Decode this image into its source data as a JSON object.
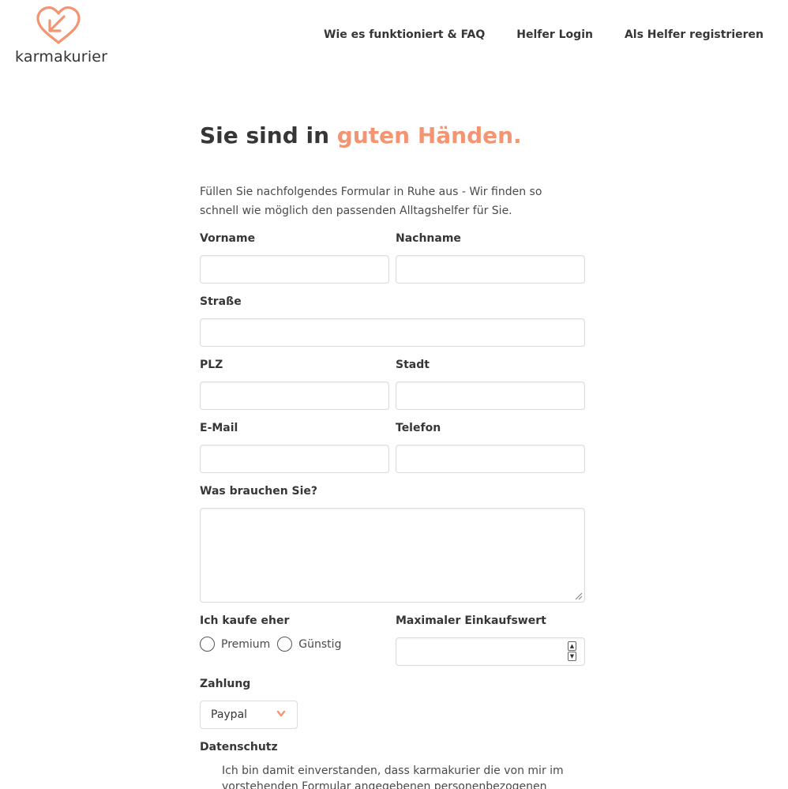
{
  "brand": {
    "name": "karmakurier",
    "accent_color": "#f39472",
    "logo_icon": "heart-arrow-icon"
  },
  "nav": [
    {
      "label": "Wie es funktioniert & FAQ"
    },
    {
      "label": "Helfer Login"
    },
    {
      "label": "Als Helfer registrieren"
    }
  ],
  "hero": {
    "title_plain": "Sie sind in ",
    "title_accent": "guten Händen."
  },
  "intro": "Füllen Sie nachfolgendes Formular in Ruhe aus - Wir finden so schnell wie möglich den passenden Alltagshelfer für Sie.",
  "form": {
    "first_name": {
      "label": "Vorname",
      "value": ""
    },
    "last_name": {
      "label": "Nachname",
      "value": ""
    },
    "street": {
      "label": "Straße",
      "value": ""
    },
    "zip": {
      "label": "PLZ",
      "value": ""
    },
    "city": {
      "label": "Stadt",
      "value": ""
    },
    "email": {
      "label": "E-Mail",
      "value": ""
    },
    "phone": {
      "label": "Telefon",
      "value": ""
    },
    "needs": {
      "label": "Was brauchen Sie?",
      "value": ""
    },
    "buy_preference": {
      "label": "Ich kaufe eher",
      "options": [
        "Premium",
        "Günstig"
      ]
    },
    "max_value": {
      "label": "Maximaler Einkaufswert",
      "value": ""
    },
    "payment": {
      "label": "Zahlung",
      "selected": "Paypal"
    },
    "privacy": {
      "label": "Datenschutz",
      "text": "Ich bin damit einverstanden, dass karmakurier die von mir im vorstehenden Formular angegebenen personenbezogenen"
    }
  }
}
